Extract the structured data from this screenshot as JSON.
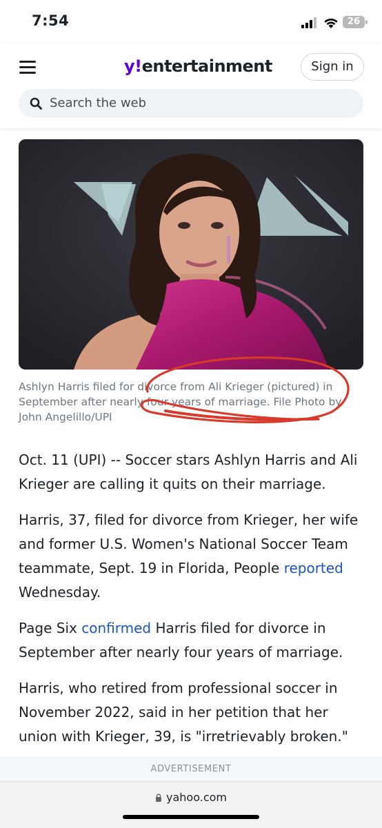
{
  "status_bar": {
    "time": "7:54",
    "battery": "26"
  },
  "header": {
    "logo_y": "y!",
    "logo_word": "entertainment",
    "sign_in_label": "Sign in",
    "search_placeholder": "Search the web"
  },
  "hero": {
    "caption": "Ashlyn Harris filed for divorce from Ali Krieger (pictured) in September after nearly four years of marriage. File Photo by John Angelillo/UPI"
  },
  "article": {
    "p1": "Oct. 11 (UPI) -- Soccer stars Ashlyn Harris and Ali Krieger are calling it quits on their marriage.",
    "p2_before": "Harris, 37, filed for divorce from Krieger, her wife and former U.S. Women's National Soccer Team teammate, Sept. 19 in Florida, People ",
    "p2_link": "reported",
    "p2_after": " Wednesday.",
    "p3_before": "Page Six ",
    "p3_link": "confirmed",
    "p3_after": " Harris filed for divorce in September after nearly four years of marriage.",
    "p4": "Harris, who retired from professional soccer in November 2022, said in her petition that her union with Krieger, 39, is \"irretrievably broken.\""
  },
  "ad_label": "ADVERTISEMENT",
  "browser": {
    "url": "yahoo.com"
  },
  "colors": {
    "brand": "#6001d2",
    "link": "#1a55c5",
    "annotation": "#d8392b"
  },
  "icons": [
    "menu-icon",
    "search-icon",
    "lock-icon",
    "wifi-icon",
    "signal-icon",
    "battery-icon"
  ]
}
